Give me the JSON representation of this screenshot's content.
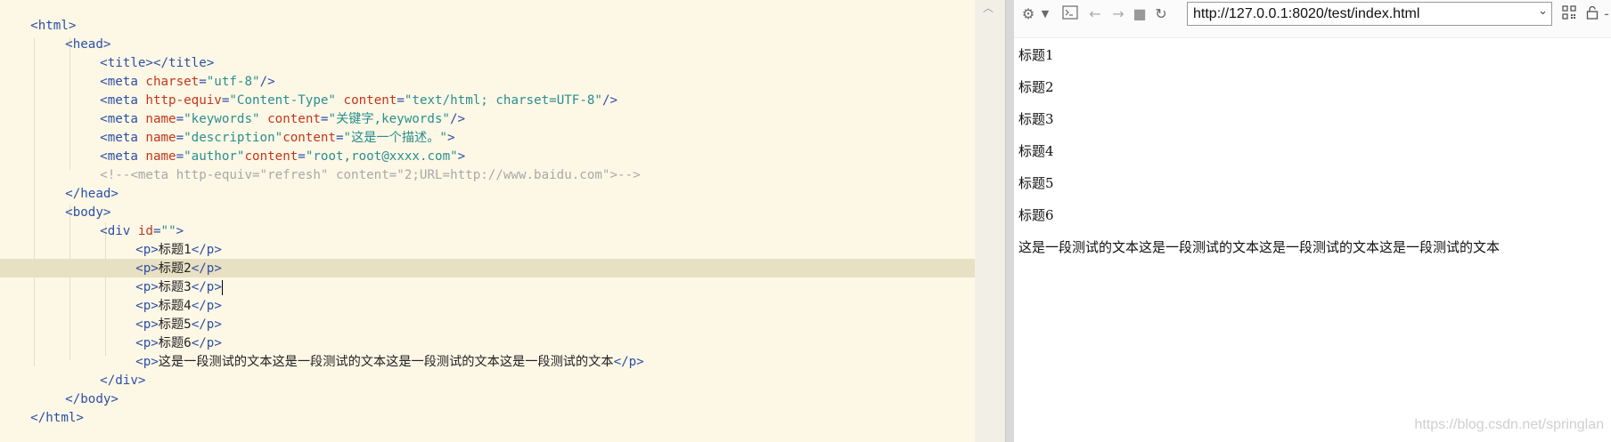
{
  "editor": {
    "lines": [
      [
        "<html>"
      ],
      [
        "<head>"
      ],
      [
        "<title></title>"
      ],
      [
        "<meta ",
        "charset",
        "=",
        "\"utf-8\"",
        "/>"
      ],
      [
        "<meta ",
        "http-equiv",
        "=",
        "\"Content-Type\"",
        " ",
        "content",
        "=",
        "\"text/html; charset=UTF-8\"",
        "/>"
      ],
      [
        "<meta ",
        "name",
        "=",
        "\"keywords\"",
        " ",
        "content",
        "=",
        "\"关键字,keywords\"",
        "/>"
      ],
      [
        "<meta ",
        "name",
        "=",
        "\"description\"",
        "content",
        "=",
        "\"这是一个描述。\"",
        ">"
      ],
      [
        "<meta ",
        "name",
        "=",
        "\"author\"",
        "content",
        "=",
        "\"root,root@xxxx.com\"",
        ">"
      ],
      [
        "<!--<meta http-equiv=\"refresh\" content=\"2;URL=http://www.baidu.com\">-->"
      ],
      [
        "</head>"
      ],
      [
        "<body>"
      ],
      [
        "<div ",
        "id",
        "=",
        "\"\"",
        ">"
      ],
      [
        "<p>",
        "标题1",
        "</p>"
      ],
      [
        "<p>",
        "标题2",
        "</p>"
      ],
      [
        "<p>",
        "标题3",
        "</p>"
      ],
      [
        "<p>",
        "标题4",
        "</p>"
      ],
      [
        "<p>",
        "标题5",
        "</p>"
      ],
      [
        "<p>",
        "标题6",
        "</p>"
      ],
      [
        "<p>",
        "这是一段测试的文本这是一段测试的文本这是一段测试的文本这是一段测试的文本",
        "</p>"
      ],
      [
        "</div>"
      ],
      [
        "</body>"
      ],
      [
        "</html>"
      ]
    ]
  },
  "browser": {
    "url": "http://127.0.0.1:8020/test/index.html",
    "paragraphs": [
      "标题1",
      "标题2",
      "标题3",
      "标题4",
      "标题5",
      "标题6",
      "这是一段测试的文本这是一段测试的文本这是一段测试的文本这是一段测试的文本"
    ]
  },
  "watermark": "https://blog.csdn.net/springlan",
  "icons": [
    "gear-icon",
    "dropdown-arrow-icon",
    "terminal-icon",
    "back-arrow-icon",
    "forward-arrow-icon",
    "stop-icon",
    "refresh-icon",
    "qr-code-icon",
    "lock-icon"
  ]
}
